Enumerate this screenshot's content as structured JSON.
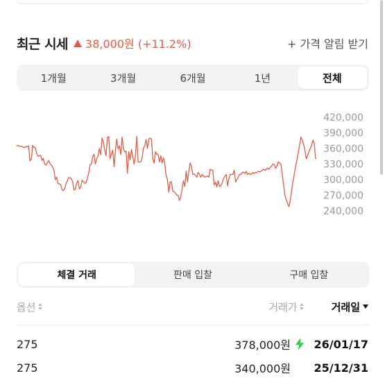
{
  "price": {
    "title": "최근 시세",
    "change": "38,000원 (+11.2%)",
    "alert_label": "+ 가격 알림 받기",
    "trend_color": "#e15b45"
  },
  "period_tabs": [
    {
      "label": "1개월",
      "active": false
    },
    {
      "label": "3개월",
      "active": false
    },
    {
      "label": "6개월",
      "active": false
    },
    {
      "label": "1년",
      "active": false
    },
    {
      "label": "전체",
      "active": true
    }
  ],
  "chart_data": {
    "type": "line",
    "y_ticks": [
      "420,000",
      "390,000",
      "360,000",
      "330,000",
      "300,000",
      "270,000",
      "240,000"
    ],
    "ylim": [
      240000,
      420000
    ],
    "line_color": "#e15b45",
    "series": [
      {
        "values": [
          365000,
          366000,
          364000,
          364000,
          364000,
          362000,
          362000,
          364000,
          363000,
          365000,
          336000,
          340000,
          366000,
          362000,
          362000,
          350000,
          345000,
          346000,
          347000,
          337000,
          341000,
          330000,
          328000,
          332000,
          337000,
          331000,
          328000,
          324000,
          317000,
          300000,
          305000,
          292000,
          292000,
          290000,
          281000,
          279000,
          283000,
          292000,
          298000,
          304000,
          304000,
          302000,
          296000,
          280000,
          282000,
          294000,
          298000,
          282000,
          286000,
          299000,
          296000,
          293000,
          294000,
          303000,
          313000,
          329000,
          330000,
          345000,
          349000,
          330000,
          340000,
          346000,
          360000,
          348000,
          380000,
          372000,
          357000,
          346000,
          381000,
          383000,
          340000,
          349000,
          357000,
          325000,
          355000,
          378000,
          359000,
          365000,
          348000,
          382000,
          360000,
          353000,
          355000,
          312000,
          354000,
          338000,
          358000,
          345000,
          330000,
          345000,
          383000,
          334000,
          334000,
          334000,
          342000,
          361000,
          365000,
          377000,
          360000,
          378000,
          380000,
          378000,
          340000,
          332000,
          354000,
          349000,
          348000,
          334000,
          346000,
          332000,
          342000,
          330000,
          308000,
          300000,
          276000,
          296000,
          296000,
          278000,
          277000,
          274000,
          270000,
          270000,
          260000,
          268000,
          283000,
          298000,
          287000,
          316000,
          296000,
          316000,
          332000,
          325000,
          310000,
          311000,
          308000,
          305000,
          314000,
          310000,
          305000,
          310000,
          307000,
          305000,
          306000,
          307000,
          305000,
          320000,
          318000,
          318000,
          290000,
          295000,
          286000,
          298000,
          287000,
          288000,
          294000,
          302000,
          306000,
          310000,
          288000,
          302000,
          310000,
          310000,
          310000,
          318000,
          296000,
          300000,
          305000,
          310000,
          310000,
          314000,
          314000,
          312000,
          316000,
          310000,
          312000,
          310000,
          311000,
          314000,
          312000,
          314000,
          314000,
          316000,
          315000,
          316000,
          318000,
          320000,
          318000,
          320000,
          322000,
          320000,
          324000,
          326000,
          330000,
          329000,
          322000,
          326000,
          334000,
          332000,
          330000,
          310000,
          290000,
          270000,
          262000,
          254000,
          248000,
          260000,
          280000,
          296000,
          310000,
          325000,
          338000,
          352000,
          366000,
          382000,
          376000,
          368000,
          356000,
          340000,
          347000,
          354000,
          360000,
          366000,
          376000,
          369000,
          340000
        ]
      }
    ]
  },
  "trade_tabs": [
    {
      "label": "체결 거래",
      "active": true
    },
    {
      "label": "판매 입찰",
      "active": false
    },
    {
      "label": "구매 입찰",
      "active": false
    }
  ],
  "table": {
    "headers": {
      "option": "옵션",
      "price": "거래가",
      "date": "거래일"
    },
    "rows": [
      {
        "option": "275",
        "price": "378,000원",
        "date": "26/01/17",
        "fast_delivery": true
      },
      {
        "option": "275",
        "price": "340,000원",
        "date": "25/12/31",
        "fast_delivery": false
      }
    ],
    "fast_delivery_color": "#2ecc4a"
  }
}
